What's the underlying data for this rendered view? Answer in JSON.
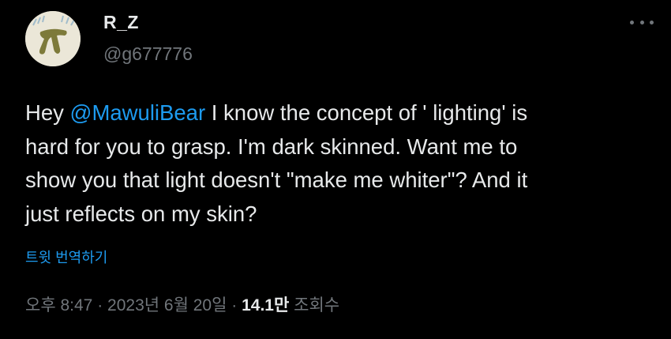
{
  "author": {
    "display_name": "R_Z",
    "handle": "@g677776",
    "avatar_icon": "custom-avatar"
  },
  "more_icon": "ellipsis-icon",
  "tweet": {
    "text_before": "Hey ",
    "mention": "@MawuliBear",
    "text_after": " I know the concept of ' lighting' is\nhard for you to grasp. I'm dark skinned. Want me to\nshow you that light doesn't \"make me whiter\"? And it\njust reflects on my skin?"
  },
  "translate_label": "트윗 번역하기",
  "meta": {
    "time": "오후 8:47",
    "separator1": " · ",
    "date": "2023년 6월 20일",
    "separator2": " · ",
    "views_count": "14.1만",
    "views_label": " 조회수"
  },
  "colors": {
    "background": "#000000",
    "text": "#e7e9ea",
    "secondary": "#71767b",
    "accent": "#1d9bf0"
  }
}
